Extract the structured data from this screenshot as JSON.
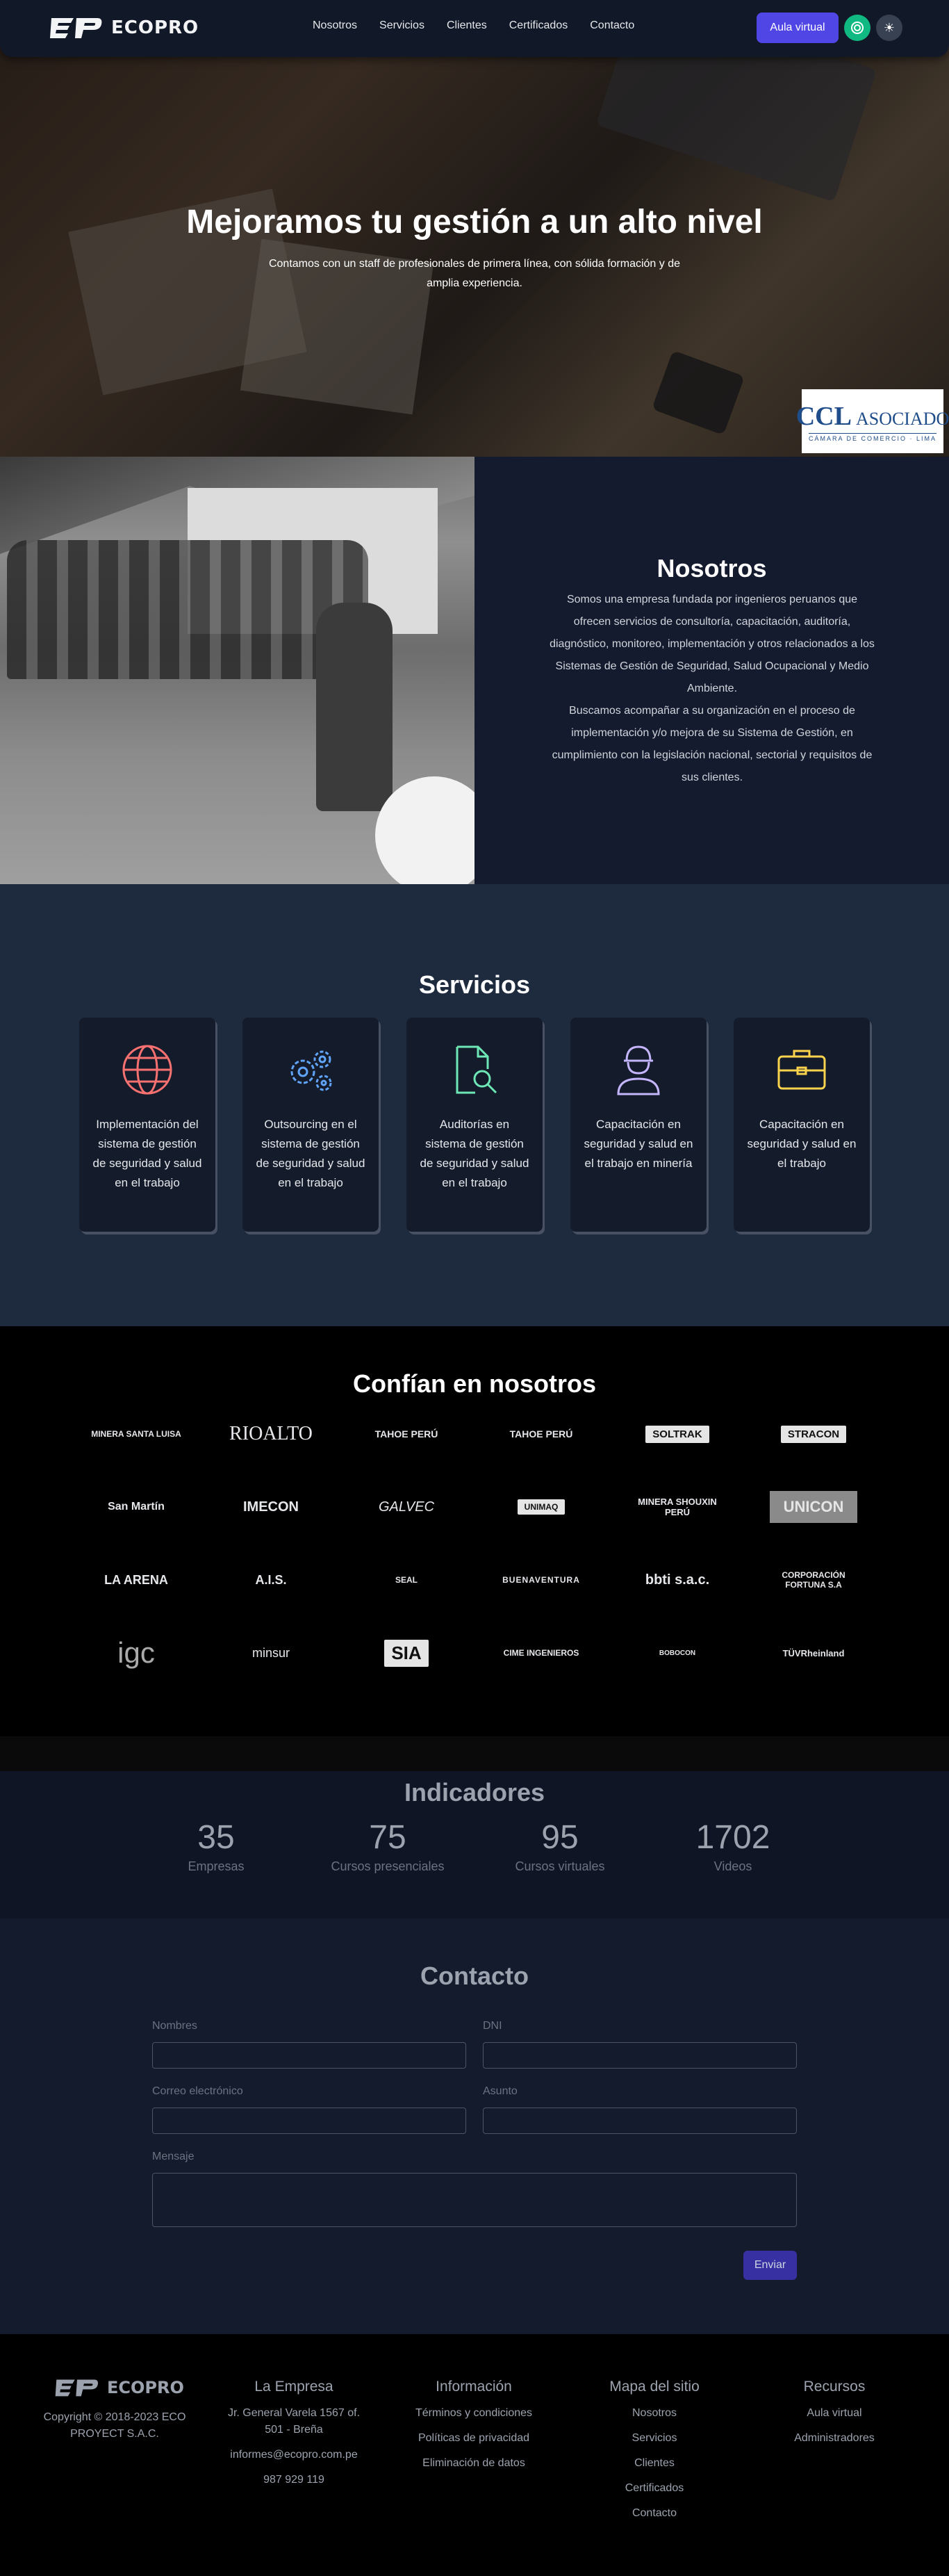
{
  "header": {
    "brand": "ECOPRO",
    "nav": [
      "Nosotros",
      "Servicios",
      "Clientes",
      "Certificados",
      "Contacto"
    ],
    "aula_label": "Aula virtual",
    "theme_icon": "sun-icon"
  },
  "hero": {
    "title": "Mejoramos tu gestión a un alto nivel",
    "subtitle": "Contamos con un staff de profesionales de primera línea, con sólida formación y de amplia experiencia.",
    "badge": {
      "big": "CCL",
      "word": "ASOCIADO",
      "small": "CÁMARA DE COMERCIO · LIMA"
    }
  },
  "nosotros": {
    "title": "Nosotros",
    "paragraph1": "Somos una empresa fundada por ingenieros peruanos que ofrecen servicios de consultoría, capacitación, auditoría, diagnóstico, monitoreo, implementación y otros relacionados a los Sistemas de Gestión de Seguridad, Salud Ocupacional y Medio Ambiente.",
    "paragraph2": "Buscamos acompañar a su organización en el proceso de implementación y/o mejora de su Sistema de Gestión, en cumplimiento con la legislación nacional, sectorial y requisitos de sus clientes."
  },
  "servicios": {
    "title": "Servicios",
    "items": [
      {
        "label": "Implementación del sistema de gestión de seguridad y salud en el trabajo",
        "icon": "globe-icon",
        "color": "#f87171"
      },
      {
        "label": "Outsourcing en el sistema de gestión de seguridad y salud en el trabajo",
        "icon": "gears-icon",
        "color": "#60a5fa"
      },
      {
        "label": "Auditorías en sistema de gestión de seguridad y salud en el trabajo",
        "icon": "document-search-icon",
        "color": "#6ee7b7"
      },
      {
        "label": "Capacitación en seguridad y salud en el trabajo en minería",
        "icon": "worker-icon",
        "color": "#c4b5fd"
      },
      {
        "label": "Capacitación en seguridad y salud en el trabajo",
        "icon": "briefcase-icon",
        "color": "#fcd34d"
      }
    ]
  },
  "clientes": {
    "title": "Confían en nosotros",
    "logos": [
      "MINERA SANTA LUISA",
      "RIOALTO",
      "TAHOE PERÚ",
      "TAHOE PERÚ",
      "SOLTRAK",
      "STRACON",
      "San Martín",
      "IMECON",
      "GALVEC",
      "UNIMAQ",
      "MINERA SHOUXIN PERÚ",
      "UNICON",
      "LA ARENA",
      "A.I.S.",
      "SEAL",
      "BUENAVENTURA",
      "bbti s.a.c.",
      "CORPORACIÓN FORTUNA S.A",
      "igc",
      "minsur",
      "SIA",
      "CIME INGENIEROS",
      "BOBOCON",
      "TÜVRheinland"
    ]
  },
  "indicadores": {
    "title": "Indicadores",
    "stats": [
      {
        "value": "35",
        "label": "Empresas"
      },
      {
        "value": "75",
        "label": "Cursos presenciales"
      },
      {
        "value": "95",
        "label": "Cursos virtuales"
      },
      {
        "value": "1702",
        "label": "Videos"
      }
    ]
  },
  "contacto": {
    "title": "Contacto",
    "fields": {
      "nombres": "Nombres",
      "dni": "DNI",
      "email": "Correo electrónico",
      "asunto": "Asunto",
      "mensaje": "Mensaje"
    },
    "submit": "Enviar"
  },
  "footer": {
    "brand": "ECOPRO",
    "copyright": "Copyright © 2018-2023 ECO PROYECT S.A.C.",
    "empresa": {
      "title": "La Empresa",
      "address": "Jr. General Varela 1567 of. 501 - Breña",
      "email": "informes@ecopro.com.pe",
      "phone": "987 929 119"
    },
    "informacion": {
      "title": "Información",
      "links": [
        "Términos y condiciones",
        "Políticas de privacidad",
        "Eliminación de datos"
      ]
    },
    "mapa": {
      "title": "Mapa del sitio",
      "links": [
        "Nosotros",
        "Servicios",
        "Clientes",
        "Certificados",
        "Contacto"
      ]
    },
    "recursos": {
      "title": "Recursos",
      "links": [
        "Aula virtual",
        "Administradores"
      ]
    }
  }
}
